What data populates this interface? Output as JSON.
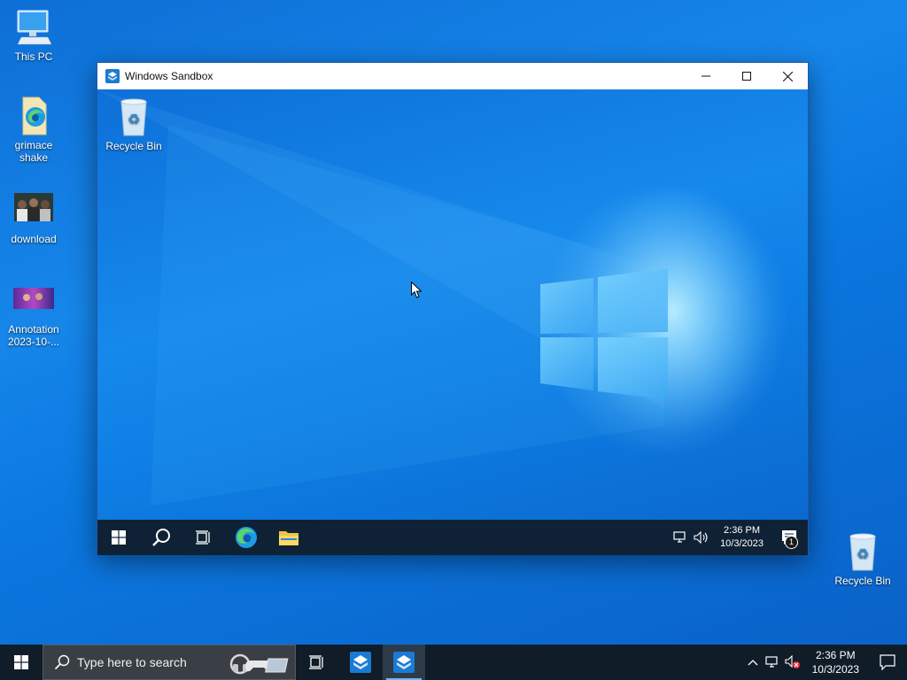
{
  "desktop": {
    "icons": [
      {
        "label": "This PC"
      },
      {
        "label": "grimace shake"
      },
      {
        "label": "download"
      },
      {
        "label": "Annotation 2023-10-..."
      },
      {
        "label": "Recycle Bin"
      }
    ]
  },
  "sandbox_window": {
    "title": "Windows Sandbox",
    "desktop_icons": [
      {
        "label": "Recycle Bin"
      }
    ],
    "taskbar": {
      "clock_time": "2:36 PM",
      "clock_date": "10/3/2023",
      "notification_count": "1"
    }
  },
  "taskbar": {
    "search_placeholder": "Type here to search",
    "clock_time": "2:36 PM",
    "clock_date": "10/3/2023"
  },
  "colors": {
    "desktop_blue": "#0b6fd8",
    "taskbar_bg": "#101c28",
    "inner_taskbar_bg": "#0f2235",
    "accent": "#6fb5f0"
  }
}
